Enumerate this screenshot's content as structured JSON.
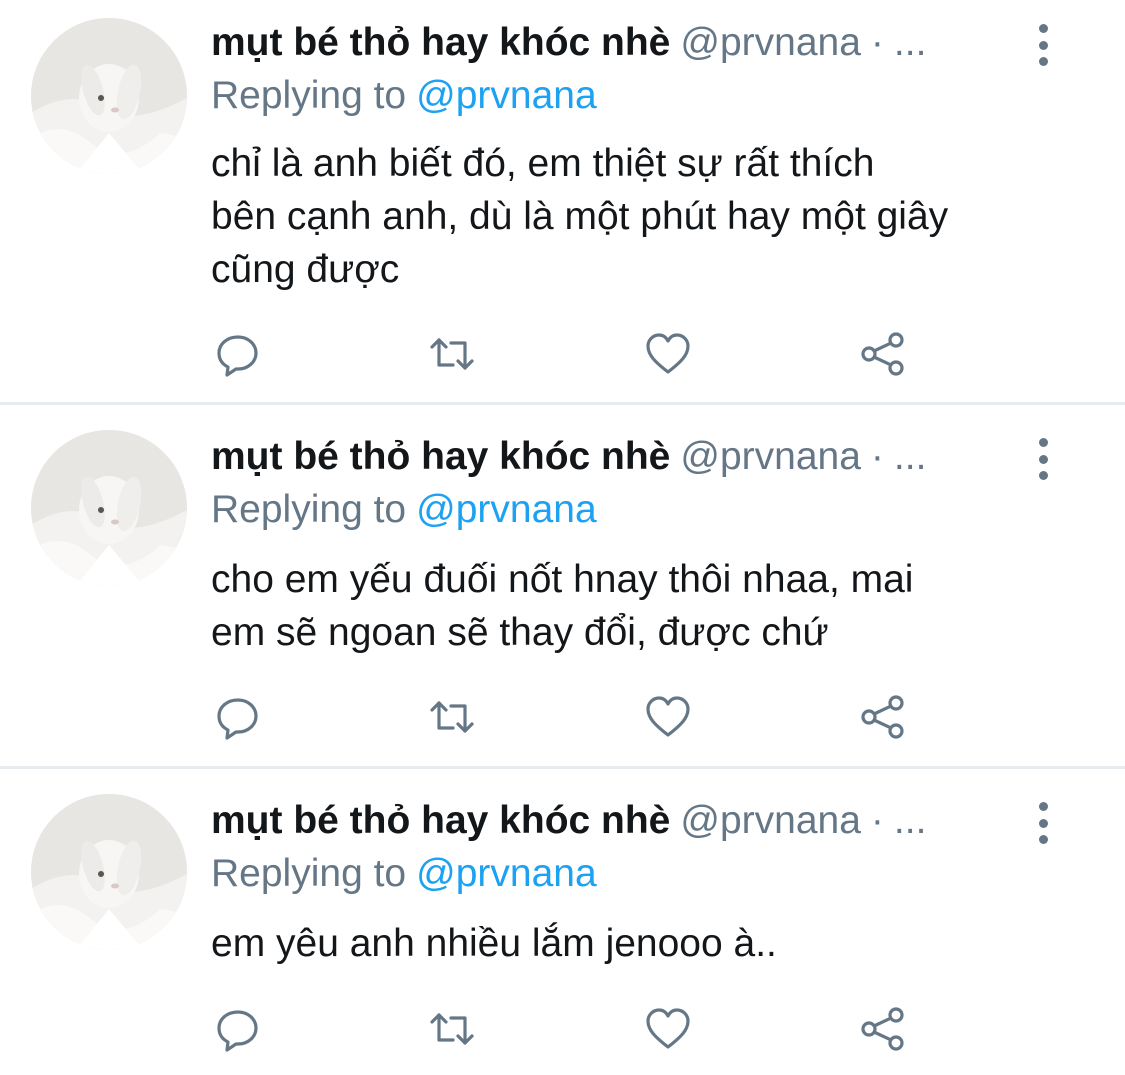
{
  "colors": {
    "text": "#14171a",
    "secondary": "#657786",
    "link": "#1da1f2",
    "divider": "#e6ecf0"
  },
  "tweets": [
    {
      "display_name": "mụt bé thỏ hay khóc nhè",
      "handle": "@prvnana",
      "separator": "·",
      "time": "...",
      "replying_label": "Replying to",
      "replying_to": "@prvnana",
      "text_lines": [
        "chỉ là anh biết đó, em thiệt sự rất thích",
        "bên cạnh anh, dù là một phút hay một giây",
        "cũng được"
      ],
      "actions": [
        "reply-icon",
        "retweet-icon",
        "like-icon",
        "share-icon"
      ]
    },
    {
      "display_name": "mụt bé thỏ hay khóc nhè",
      "handle": "@prvnana",
      "separator": "·",
      "time": "...",
      "replying_label": "Replying to",
      "replying_to": "@prvnana",
      "text_lines": [
        "cho em yếu đuối nốt hnay thôi nhaa, mai",
        "em sẽ ngoan sẽ thay đổi, được chứ"
      ],
      "actions": [
        "reply-icon",
        "retweet-icon",
        "like-icon",
        "share-icon"
      ]
    },
    {
      "display_name": "mụt bé thỏ hay khóc nhè",
      "handle": "@prvnana",
      "separator": "·",
      "time": "...",
      "replying_label": "Replying to",
      "replying_to": "@prvnana",
      "text_lines": [
        "em yêu anh nhiều lắm jenooo à.."
      ],
      "actions": [
        "reply-icon",
        "retweet-icon",
        "like-icon",
        "share-icon"
      ]
    }
  ]
}
